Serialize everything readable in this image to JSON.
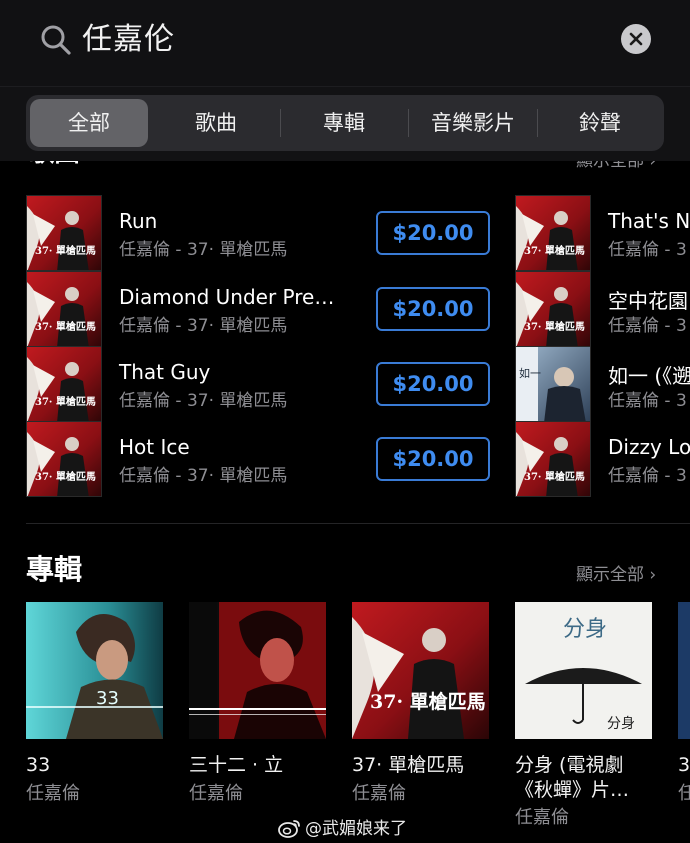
{
  "search": {
    "query": "任嘉伦"
  },
  "tabs": [
    {
      "label": "全部",
      "active": true
    },
    {
      "label": "歌曲",
      "active": false
    },
    {
      "label": "專輯",
      "active": false
    },
    {
      "label": "音樂影片",
      "active": false
    },
    {
      "label": "鈴聲",
      "active": false
    }
  ],
  "songs_section": {
    "title": "歌曲",
    "show_all": "顯示全部"
  },
  "songs": [
    {
      "title": "Run",
      "subtitle": "任嘉倫 - 37· 單槍匹馬",
      "price": "$20.00"
    },
    {
      "title": "Diamond Under Pre…",
      "subtitle": "任嘉倫 - 37· 單槍匹馬",
      "price": "$20.00"
    },
    {
      "title": "That Guy",
      "subtitle": "任嘉倫 - 37· 單槍匹馬",
      "price": "$20.00"
    },
    {
      "title": "Hot Ice",
      "subtitle": "任嘉倫 - 37· 單槍匹馬",
      "price": "$20.00"
    }
  ],
  "songs_right": [
    {
      "title": "That's N",
      "subtitle": "任嘉倫 - 3"
    },
    {
      "title": "空中花園",
      "subtitle": "任嘉倫 - 3"
    },
    {
      "title": "如一 (《遡",
      "subtitle": "任嘉倫 - 3"
    },
    {
      "title": "Dizzy Lo",
      "subtitle": "任嘉倫 - 3"
    }
  ],
  "albums_section": {
    "title": "專輯",
    "show_all": "顯示全部"
  },
  "albums": [
    {
      "name": "33",
      "name2": "",
      "artist": "任嘉倫"
    },
    {
      "name": "三十二 · 立",
      "name2": "",
      "artist": "任嘉倫"
    },
    {
      "name": "37· 單槍匹馬",
      "name2": "",
      "artist": "任嘉倫"
    },
    {
      "name": "分身 (電視劇",
      "name2": "《秋蟬》片…",
      "artist": "任嘉倫"
    },
    {
      "name": "3",
      "name2": "",
      "artist": "任"
    }
  ],
  "album_cover_text": {
    "cover37": "37· 單槍匹馬",
    "cover_fenshen": "分身",
    "cover_fenshen_sig": "分身",
    "cover_33": "33",
    "cover_rugyi": "如一"
  },
  "watermark": "@武媚娘来了",
  "colors": {
    "accent": "#3f8cf0",
    "background": "#000000",
    "secondary_text": "#8e8e93"
  }
}
